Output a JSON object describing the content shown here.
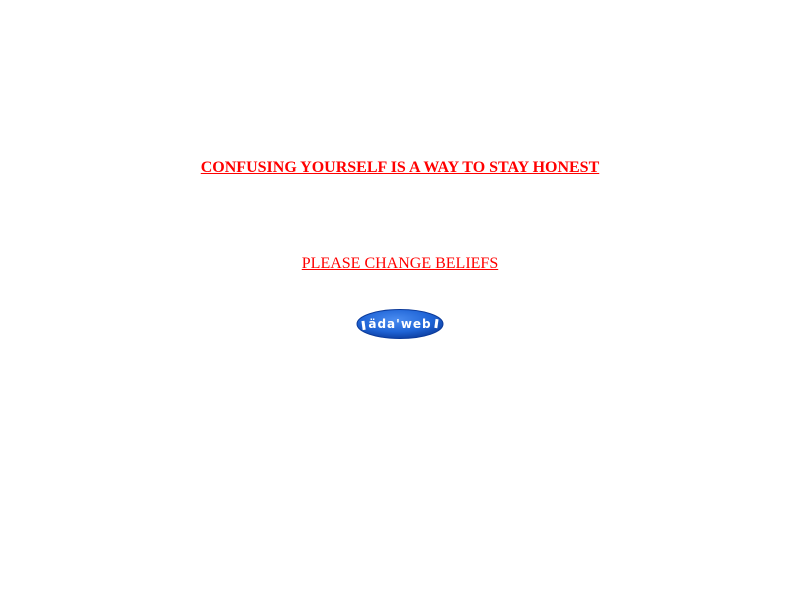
{
  "headline": {
    "text": "CONFUSING YOURSELF IS A WAY TO STAY HONEST"
  },
  "subline": {
    "text": "PLEASE CHANGE BELIEFS"
  },
  "logo": {
    "text": "äda'web",
    "icon": "adaweb-logo-icon",
    "fill": "#1f64d6",
    "edge": "#0b3a9a",
    "text_color": "#ffffff"
  },
  "colors": {
    "link": "#ff0000",
    "background": "#ffffff"
  }
}
